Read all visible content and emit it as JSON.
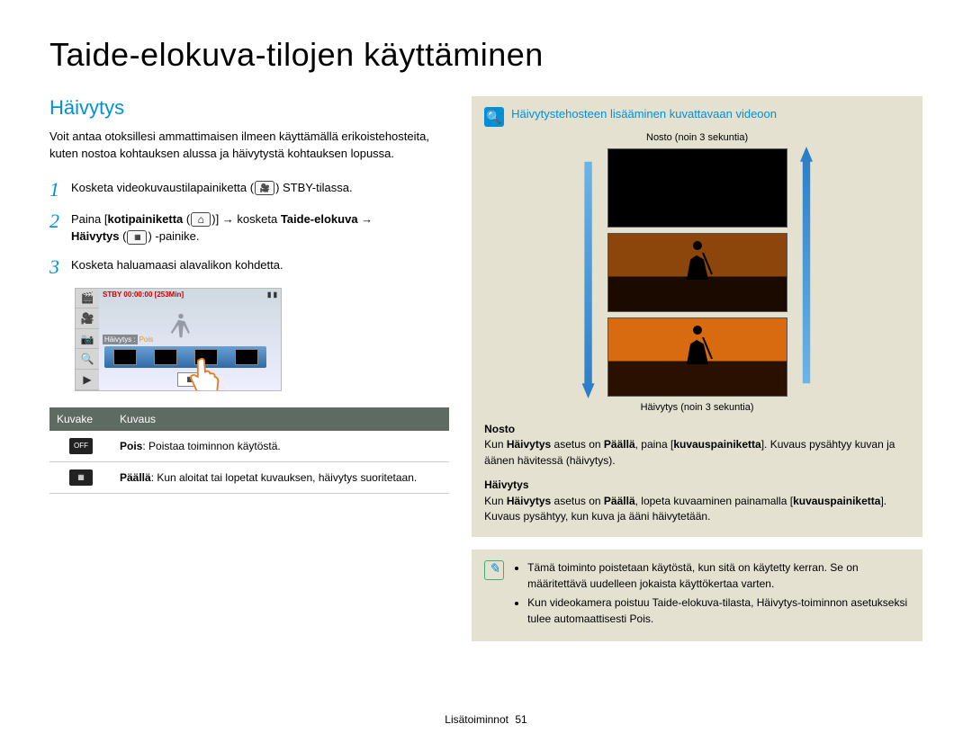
{
  "title": "Taide-elokuva-tilojen käyttäminen",
  "section": {
    "heading": "Häivytys",
    "intro": "Voit antaa otoksillesi ammattimaisen ilmeen käyttämällä erikoistehosteita, kuten nostoa kohtauksen alussa ja häivytystä kohtauksen lopussa."
  },
  "steps": [
    {
      "num": "1",
      "pre": "Kosketa videokuvaustilapainiketta (",
      "post": ") STBY-tilassa."
    },
    {
      "num": "2",
      "p1": "Paina [",
      "p2_bold": "kotipainiketta",
      "p3": " (",
      "p4": ")] → kosketa ",
      "p5_bold": "Taide-elokuva",
      "p6": " → ",
      "line2_bold": "Häivytys",
      "line2_mid": " (",
      "line2_end": ") -painike."
    },
    {
      "num": "3",
      "text": "Kosketa haluamaasi alavalikon kohdetta."
    }
  ],
  "lcd": {
    "top_left": "STBY 00:00:00 [253Min]",
    "label_key": "Häivytys :",
    "label_val": "Pois"
  },
  "table": {
    "headers": [
      "Kuvake",
      "Kuvaus"
    ],
    "rows": [
      {
        "icon": "OFF",
        "label_bold": "Pois",
        "label_rest": ": Poistaa toiminnon käytöstä."
      },
      {
        "icon": "▦",
        "label_bold": "Päällä",
        "label_rest": ": Kun aloitat tai lopetat kuvauksen, häivytys suoritetaan."
      }
    ]
  },
  "right": {
    "title": "Häivytystehosteen lisääminen kuvattavaan videoon",
    "captions": {
      "top": "Nosto (noin 3 sekuntia)",
      "bottom": "Häivytys (noin 3 sekuntia)"
    },
    "blocks": [
      {
        "title": "Nosto",
        "t1": "Kun ",
        "t2_bold": "Häivytys",
        "t3": " asetus on ",
        "t4_bold": "Päällä",
        "t5": ", paina [",
        "t6_bold": "kuvauspainiketta",
        "t7": "]. Kuvaus pysähtyy kuvan ja äänen hävitessä (häivytys)."
      },
      {
        "title": "Häivytys",
        "t1": "Kun ",
        "t2_bold": "Häivytys",
        "t3": " asetus on ",
        "t4_bold": "Päällä",
        "t5": ", lopeta kuvaaminen painamalla [",
        "t6_bold": "kuvauspainiketta",
        "t7": "]. Kuvaus pysähtyy, kun kuva ja ääni häivytetään."
      }
    ]
  },
  "note": {
    "items": [
      "Tämä toiminto poistetaan käytöstä, kun sitä on käytetty kerran. Se on määritettävä uudelleen jokaista käyttökertaa varten.",
      "Kun videokamera poistuu Taide-elokuva-tilasta, Häivytys-toiminnon asetukseksi tulee automaattisesti Pois."
    ],
    "pois_bold": "Pois"
  },
  "footer": {
    "section": "Lisätoiminnot",
    "page": "51"
  }
}
